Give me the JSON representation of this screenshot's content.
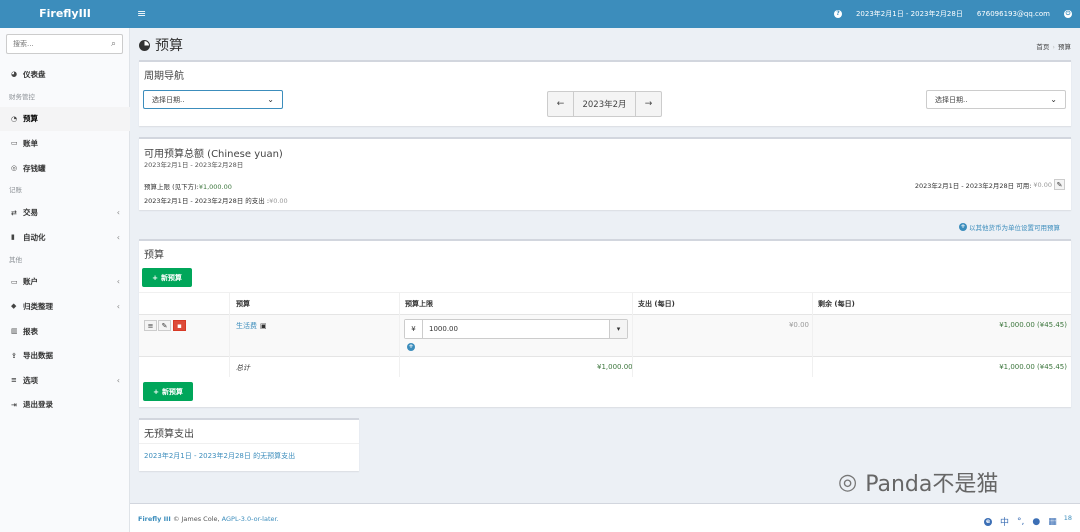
{
  "header": {
    "logo": "FireflyIII",
    "hamburger": "≡",
    "help_icon": "?",
    "date_range": "2023年2月1日 - 2023年2月28日",
    "user": "676096193@qq.com",
    "logout_icon": "⏻"
  },
  "sidebar": {
    "search_placeholder": "搜索...",
    "items": [
      {
        "type": "item",
        "icon": "dashboard-icon",
        "glyph": "◕",
        "label": "仪表盘"
      },
      {
        "type": "header",
        "label": "财务管控"
      },
      {
        "type": "item",
        "icon": "pie-chart-icon",
        "glyph": "◔",
        "label": "预算",
        "active": true
      },
      {
        "type": "item",
        "icon": "calendar-icon",
        "glyph": "▭",
        "label": "账单"
      },
      {
        "type": "item",
        "icon": "target-icon",
        "glyph": "◎",
        "label": "存钱罐"
      },
      {
        "type": "header",
        "label": "记账"
      },
      {
        "type": "item",
        "icon": "exchange-icon",
        "glyph": "⇄",
        "label": "交易",
        "chevron": true
      },
      {
        "type": "item",
        "icon": "robot-icon",
        "glyph": "▮",
        "label": "自动化",
        "chevron": true
      },
      {
        "type": "header",
        "label": "其他"
      },
      {
        "type": "item",
        "icon": "credit-card-icon",
        "glyph": "▭",
        "label": "账户",
        "chevron": true
      },
      {
        "type": "item",
        "icon": "tag-icon",
        "glyph": "◆",
        "label": "归类整理",
        "chevron": true
      },
      {
        "type": "item",
        "icon": "bar-chart-icon",
        "glyph": "▥",
        "label": "报表"
      },
      {
        "type": "item",
        "icon": "upload-icon",
        "glyph": "⇪",
        "label": "导出数据"
      },
      {
        "type": "item",
        "icon": "sliders-icon",
        "glyph": "≡",
        "label": "选项",
        "chevron": true
      },
      {
        "type": "item",
        "icon": "sign-out-icon",
        "glyph": "⇥",
        "label": "退出登录"
      }
    ]
  },
  "page": {
    "title": "预算",
    "breadcrumb": [
      "首页",
      "预算"
    ]
  },
  "period_nav": {
    "title": "周期导航",
    "select_left": "选择日期..",
    "select_right": "选择日期..",
    "prev": "←",
    "current": "2023年2月",
    "next": "→"
  },
  "available": {
    "title": "可用预算总额 (Chinese yuan)",
    "subtitle": "2023年2月1日 - 2023年2月28日",
    "limit_label": "预算上限 (见下方):",
    "limit_value": "¥1,000.00",
    "spent_label": "2023年2月1日 - 2023年2月28日 的支出 :",
    "spent_value": "¥0.00",
    "right_label": "2023年2月1日 - 2023年2月28日 可用:",
    "right_value": "¥0.00",
    "other_currency_link": "以其他货币为单位设置可用预算"
  },
  "budgets": {
    "title": "预算",
    "new_button": "新预算",
    "columns": [
      "预算",
      "预算上限",
      "支出 (每日)",
      "剩余 (每日)"
    ],
    "rows": [
      {
        "name": "生活费",
        "currency": "¥",
        "limit_input": "1000.00",
        "spent": "¥0.00",
        "left": "¥1,000.00 (¥45.45)"
      }
    ],
    "total_label": "总计",
    "total_limit": "¥1,000.00",
    "total_left": "¥1,000.00 (¥45.45)"
  },
  "no_budget": {
    "title": "无预算支出",
    "link": "2023年2月1日 - 2023年2月28日 的无预算支出"
  },
  "footer": {
    "brand": "Firefly III",
    "copyright": "© James Cole,",
    "license": "AGPL-3.0-or-later.",
    "version_fragment": "18"
  },
  "watermark": {
    "text": "Panda不是猫",
    "ime_label": "中"
  },
  "colors": {
    "topbar": "#3c8dbc",
    "success": "#00a65a",
    "danger": "#dd4b39"
  }
}
